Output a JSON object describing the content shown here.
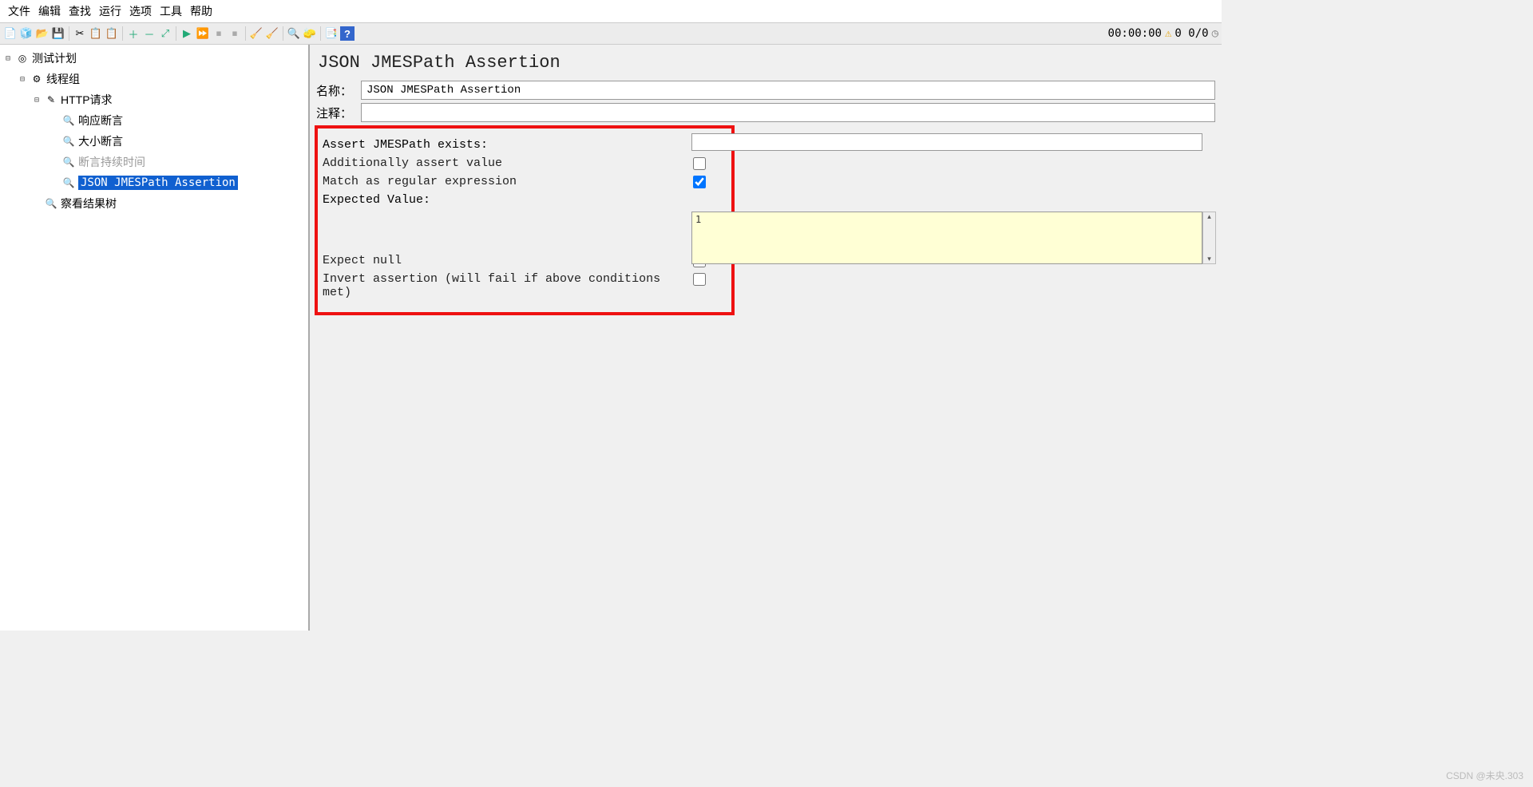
{
  "menu": {
    "file": "文件",
    "edit": "编辑",
    "search": "查找",
    "run": "运行",
    "options": "选项",
    "tools": "工具",
    "help": "帮助"
  },
  "toolbar_right": {
    "time": "00:00:00",
    "warn": "⚠",
    "counts": "0 0/0"
  },
  "tree": {
    "root": {
      "label": "测试计划"
    },
    "thread_group": {
      "label": "线程组"
    },
    "http": {
      "label": "HTTP请求"
    },
    "resp_assert": {
      "label": "响应断言"
    },
    "size_assert": {
      "label": "大小断言"
    },
    "duration_assert": {
      "label": "断言持续时间"
    },
    "jmespath": {
      "label": "JSON JMESPath Assertion"
    },
    "results_tree": {
      "label": "察看结果树"
    }
  },
  "panel": {
    "title": "JSON JMESPath Assertion",
    "name_label": "名称：",
    "name_value": "JSON JMESPath Assertion",
    "comment_label": "注释：",
    "comment_value": "",
    "assert_exists": "Assert JMESPath exists:",
    "assert_exists_value": "",
    "additionally_assert": "Additionally assert value",
    "additionally_checked": false,
    "match_regex": "Match as regular expression",
    "match_regex_checked": true,
    "expected_label": "Expected Value:",
    "expected_value": "1",
    "expect_null": "Expect null",
    "expect_null_checked": false,
    "invert": "Invert assertion (will fail if above conditions met)",
    "invert_checked": false
  },
  "watermark": "CSDN @未央.303"
}
